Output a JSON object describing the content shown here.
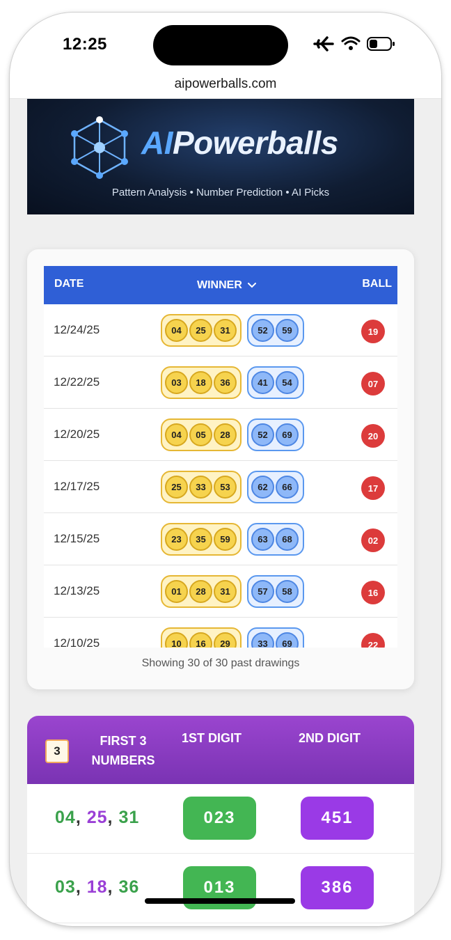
{
  "status_bar": {
    "time": "12:25"
  },
  "browser": {
    "url": "aipowerballs.com"
  },
  "banner": {
    "brand_ai": "AI",
    "brand_rest": "Powerballs",
    "tagline": "Pattern Analysis • Number Prediction • AI Picks"
  },
  "table": {
    "headers": {
      "date": "DATE",
      "winner": "WINNER",
      "ball": "BALL"
    },
    "rows": [
      {
        "date": "12/24/25",
        "first": [
          "04",
          "25",
          "31"
        ],
        "second": [
          "52",
          "59"
        ],
        "powerball": "19"
      },
      {
        "date": "12/22/25",
        "first": [
          "03",
          "18",
          "36"
        ],
        "second": [
          "41",
          "54"
        ],
        "powerball": "07"
      },
      {
        "date": "12/20/25",
        "first": [
          "04",
          "05",
          "28"
        ],
        "second": [
          "52",
          "69"
        ],
        "powerball": "20"
      },
      {
        "date": "12/17/25",
        "first": [
          "25",
          "33",
          "53"
        ],
        "second": [
          "62",
          "66"
        ],
        "powerball": "17"
      },
      {
        "date": "12/15/25",
        "first": [
          "23",
          "35",
          "59"
        ],
        "second": [
          "63",
          "68"
        ],
        "powerball": "02"
      },
      {
        "date": "12/13/25",
        "first": [
          "01",
          "28",
          "31"
        ],
        "second": [
          "57",
          "58"
        ],
        "powerball": "16"
      },
      {
        "date": "12/10/25",
        "first": [
          "10",
          "16",
          "29"
        ],
        "second": [
          "33",
          "69"
        ],
        "powerball": "22"
      }
    ],
    "showing_text": "Showing 30 of 30 past drawings"
  },
  "digits": {
    "badge": "3",
    "headers": {
      "first": "FIRST 3 NUMBERS",
      "digit1": "1ST DIGIT",
      "digit2": "2ND DIGIT"
    },
    "rows": [
      {
        "nums": [
          "04",
          "25",
          "31"
        ],
        "digit1": "023",
        "digit2": "451"
      },
      {
        "nums": [
          "03",
          "18",
          "36"
        ],
        "digit1": "013",
        "digit2": "386"
      }
    ]
  },
  "colors": {
    "table_header": "#2f5fd6",
    "powerball_red": "#dc3b3b",
    "digit1_green": "#43b653",
    "digit2_purple": "#9a3ae6"
  }
}
